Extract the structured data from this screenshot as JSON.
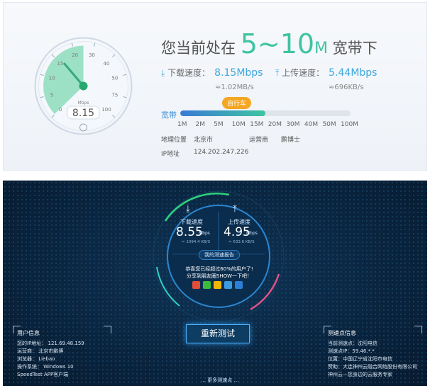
{
  "top": {
    "gauge": {
      "ticks": [
        "0",
        "5",
        "10",
        "15",
        "20",
        "30",
        "40",
        "50",
        "75",
        "100"
      ],
      "unit": "Mbps",
      "reading": "8.15"
    },
    "headline": {
      "prefix": "您当前处在",
      "range": "5~10",
      "unit": "M",
      "suffix": "宽带下"
    },
    "download": {
      "label": "下载速度：",
      "value": "8.15Mbps",
      "sub": "≈1.02MB/s"
    },
    "upload": {
      "label": "上传速度：",
      "value": "5.44Mbps",
      "sub": "≈696KB/s"
    },
    "bandwidth": {
      "label": "宽带",
      "badge": "自行车",
      "fill_fraction": 0.5,
      "ticks": [
        "1M",
        "2M",
        "5M",
        "10M",
        "15M",
        "20M",
        "30M",
        "40M",
        "50M",
        "100M"
      ]
    },
    "location": {
      "label": "地理位置",
      "value": "北京市",
      "isp_label": "运营商",
      "isp_value": "鹏博士"
    },
    "ip": {
      "label": "IP地址",
      "value": "124.202.247.226"
    }
  },
  "bottom": {
    "download": {
      "label": "下载速度",
      "value": "8.55",
      "unit": "Mbps",
      "sub": "≈ 1094.4 KB/S"
    },
    "upload": {
      "label": "上传速度",
      "value": "4.95",
      "unit": "Mbps",
      "sub": "≈ 633.6 KB/S"
    },
    "report_button": "我的测速报告",
    "share_line1": "恭喜您已经超过60%的用户了!",
    "share_line2": "分享到朋友圈SHOW一下吧！",
    "retest_button": "重新测试",
    "user_info": {
      "title": "用户信息",
      "lines": [
        "您的IP地址： 121.69.48.159",
        "运营商： 北京市鹏博",
        "浏览器： Liebao",
        "操作系统： Windows 10",
        "SpeedTest APP客户端"
      ]
    },
    "node_info": {
      "title": "测速点信息",
      "lines": [
        "当前测速点：沈阳电信",
        "测速点IP：59.46.*.*",
        "位置：中国辽宁省沈阳市电信",
        "赞助：大连神州云融合网络股份有限公司",
        "神州云—您身边的云服务专家"
      ]
    },
    "more_link": "更多测速点"
  },
  "colors": {
    "accent_green": "#3ec4a1",
    "accent_blue": "#3ea7de",
    "dark_bg": "#0a2540",
    "badge_orange": "#f5a623"
  }
}
